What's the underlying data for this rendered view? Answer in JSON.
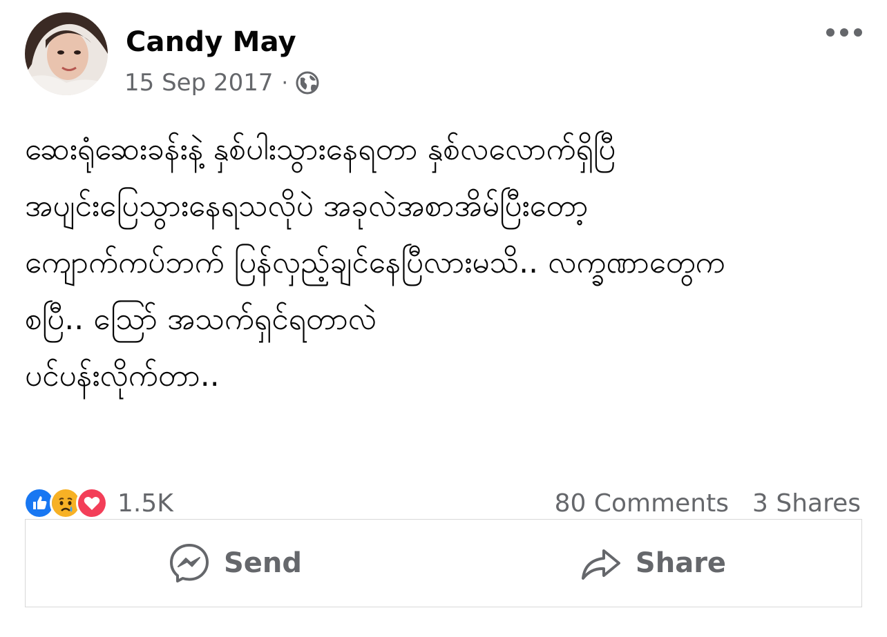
{
  "post": {
    "author": {
      "name": "Candy May",
      "avatar": "avatar-icon"
    },
    "date": "15 Sep 2017",
    "separator": "·",
    "privacy_icon": "globe-icon",
    "more_icon": "more-horizontal-icon",
    "text_lines": [
      "ဆေးရုံဆေးခန်းနဲ့ နှစ်ပါးသွားနေရတာ နှစ်လလောက်ရှိပြီ",
      "အပျင်းပြေသွားနေရသလိုပဲ အခုလဲအစာအိမ်ပြီးတော့",
      "ကျောက်ကပ်ဘက် ပြန်လှည့်ချင်နေပြီလားမသိ.. လက္ခဏာတွေက",
      "စပြီ.. သြော် အသက်ရှင်ရတာလဲ",
      "ပင်ပန်းလိုက်တာ.."
    ],
    "reactions": {
      "icons": [
        "like-icon",
        "sad-icon",
        "love-icon"
      ],
      "count": "1.5K"
    },
    "comments": "80 Comments",
    "shares": "3 Shares",
    "actions": [
      {
        "label": "Send",
        "icon": "messenger-icon"
      },
      {
        "label": "Share",
        "icon": "share-arrow-icon"
      }
    ]
  },
  "colors": {
    "text": "#050505",
    "secondary": "#65676b",
    "like": "#1877f2",
    "love": "#f33e58",
    "sad": "#f7b125"
  }
}
